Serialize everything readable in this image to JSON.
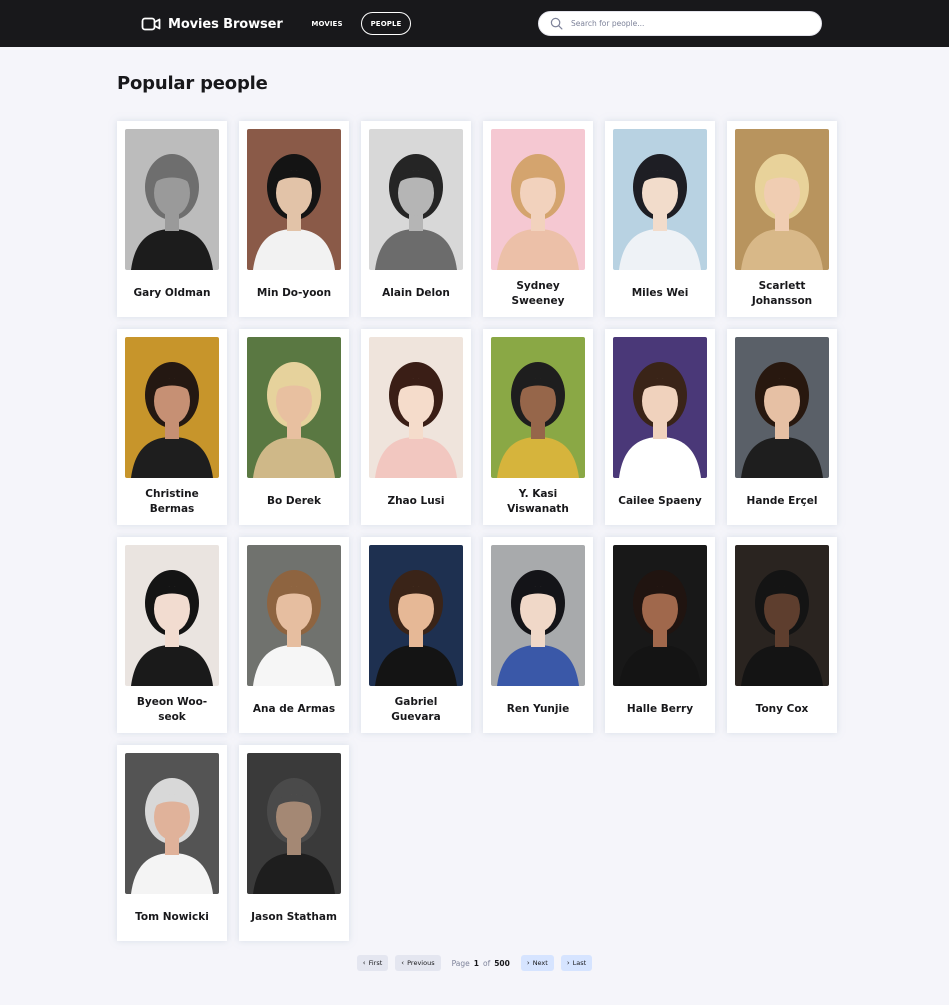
{
  "app": {
    "title": "Movies Browser",
    "nav": {
      "movies": "MOVIES",
      "people": "PEOPLE",
      "active": "people"
    },
    "search": {
      "placeholder": "Search for people...",
      "value": ""
    }
  },
  "main": {
    "title": "Popular people",
    "people": [
      {
        "name": "Gary Oldman",
        "bg": "#bcbcbc",
        "hair": "#6e6e6e",
        "skin": "#9a9a9a",
        "shirt": "#1c1c1c"
      },
      {
        "name": "Min Do-yoon",
        "bg": "#8a5a48",
        "hair": "#141414",
        "skin": "#e2c3a8",
        "shirt": "#f2f2f2"
      },
      {
        "name": "Alain Delon",
        "bg": "#d8d8d8",
        "hair": "#252525",
        "skin": "#b5b5b5",
        "shirt": "#6c6c6c"
      },
      {
        "name": "Sydney Sweeney",
        "bg": "#f5c8d2",
        "hair": "#d4a46e",
        "skin": "#f2d2bd",
        "shirt": "#ecc0a8"
      },
      {
        "name": "Miles Wei",
        "bg": "#b8d2e2",
        "hair": "#1e1e24",
        "skin": "#f2dccb",
        "shirt": "#eef2f6"
      },
      {
        "name": "Scarlett Johansson",
        "bg": "#b8945e",
        "hair": "#e8d29a",
        "skin": "#f0cdb2",
        "shirt": "#d8b888"
      },
      {
        "name": "Christine Bermas",
        "bg": "#c7952b",
        "hair": "#241812",
        "skin": "#c69074",
        "shirt": "#1e1e1e"
      },
      {
        "name": "Bo Derek",
        "bg": "#5a7842",
        "hair": "#e6d29c",
        "skin": "#e8c0a0",
        "shirt": "#cfb888"
      },
      {
        "name": "Zhao Lusi",
        "bg": "#efe4dc",
        "hair": "#3a1e16",
        "skin": "#f5dccb",
        "shirt": "#f2c7c0"
      },
      {
        "name": "Y. Kasi Viswanath",
        "bg": "#8aa845",
        "hair": "#1e1e1e",
        "skin": "#96664a",
        "shirt": "#d6b43c"
      },
      {
        "name": "Cailee Spaeny",
        "bg": "#4a3878",
        "hair": "#3a2418",
        "skin": "#f0d2bd",
        "shirt": "#ffffff"
      },
      {
        "name": "Hande Erçel",
        "bg": "#5a6068",
        "hair": "#28180f",
        "skin": "#e6c0a4",
        "shirt": "#1e1e1e"
      },
      {
        "name": "Byeon Woo-seok",
        "bg": "#eae4e0",
        "hair": "#141414",
        "skin": "#f2dcd0",
        "shirt": "#1a1a1a"
      },
      {
        "name": "Ana de Armas",
        "bg": "#70726e",
        "hair": "#8e6440",
        "skin": "#e6bea0",
        "shirt": "#f6f6f6"
      },
      {
        "name": "Gabriel Guevara",
        "bg": "#1e3050",
        "hair": "#3a2418",
        "skin": "#e6b896",
        "shirt": "#141414"
      },
      {
        "name": "Ren Yunjie",
        "bg": "#a8aaac",
        "hair": "#141418",
        "skin": "#f0d8c8",
        "shirt": "#3a58a8"
      },
      {
        "name": "Halle Berry",
        "bg": "#181818",
        "hair": "#201410",
        "skin": "#a0684c",
        "shirt": "#141414"
      },
      {
        "name": "Tony Cox",
        "bg": "#2a2420",
        "hair": "#141414",
        "skin": "#5e3e2e",
        "shirt": "#141414"
      },
      {
        "name": "Tom Nowicki",
        "bg": "#545454",
        "hair": "#d8d8d8",
        "skin": "#e0b29a",
        "shirt": "#f4f4f4"
      },
      {
        "name": "Jason Statham",
        "bg": "#3a3a3a",
        "hair": "#4a4a4a",
        "skin": "#a48874",
        "shirt": "#1e1e1e"
      }
    ]
  },
  "pagination": {
    "first": "First",
    "previous": "Previous",
    "page_label": "Page",
    "current": "1",
    "of_label": "of",
    "total": "500",
    "next": "Next",
    "last": "Last"
  },
  "icons": {
    "logo": "video-camera-icon",
    "search": "search-icon",
    "chevron_left": "chevron-left-icon",
    "chevron_right": "chevron-right-icon"
  }
}
